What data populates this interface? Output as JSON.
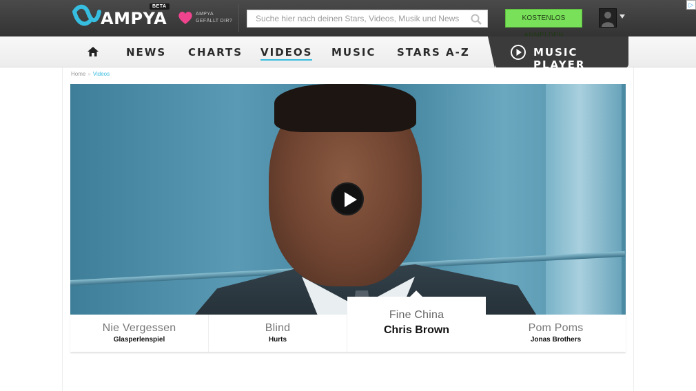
{
  "header": {
    "logo_text": "AMPYA",
    "beta_badge": "BETA",
    "like_text_line1": "AMPYA",
    "like_text_line2": "GEFÄLLT DIR?",
    "search_placeholder": "Suche hier nach deinen Stars, Videos, Musik und News",
    "signup_label": "KOSTENLOS ANMELDEN",
    "ad_corner": "▷",
    "accent_color": "#36bde0",
    "signup_color": "#79e05a"
  },
  "nav": {
    "items": [
      {
        "label": "NEWS"
      },
      {
        "label": "CHARTS"
      },
      {
        "label": "VIDEOS",
        "active": true
      },
      {
        "label": "MUSIC"
      },
      {
        "label": "STARS A-Z"
      }
    ],
    "player_label": "MUSIC PLAYER"
  },
  "breadcrumb": {
    "home": "Home",
    "separator": "»",
    "current": "Videos"
  },
  "carousel": {
    "items": [
      {
        "title": "Nie Vergessen",
        "artist": "Glasperlenspiel"
      },
      {
        "title": "Blind",
        "artist": "Hurts"
      },
      {
        "title": "Fine China",
        "artist": "Chris Brown",
        "active": true
      },
      {
        "title": "Pom Poms",
        "artist": "Jonas Brothers"
      }
    ]
  }
}
